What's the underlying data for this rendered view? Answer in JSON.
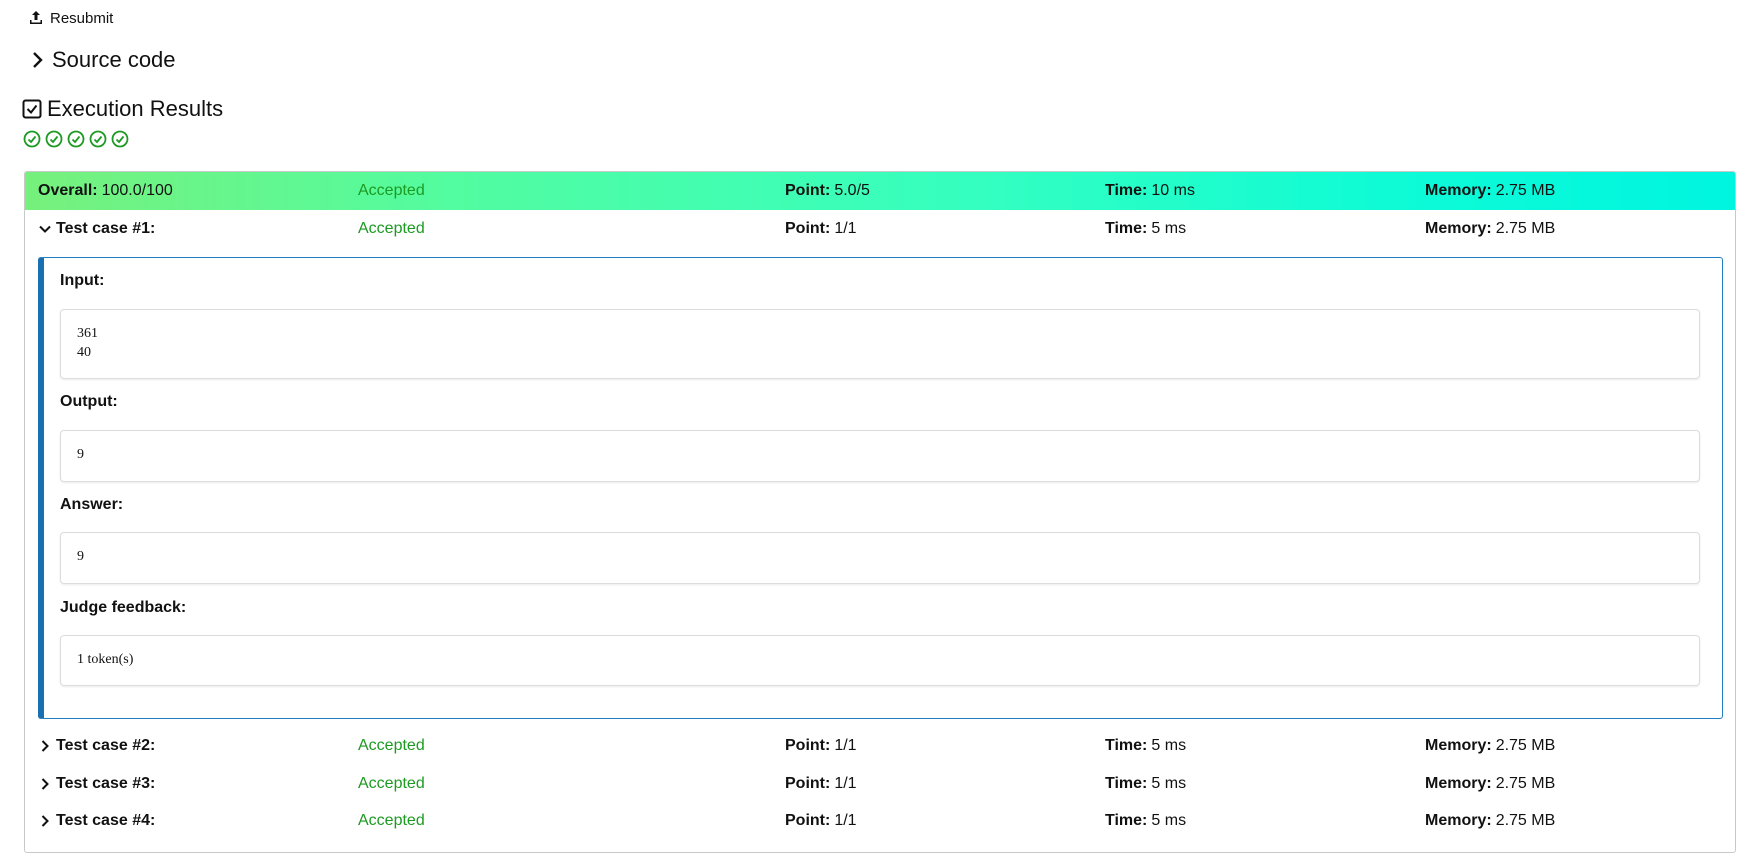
{
  "toolbar": {
    "resubmit_label": "Resubmit"
  },
  "source_code": {
    "label": "Source code"
  },
  "execution": {
    "title": "Execution Results",
    "check_count": 5
  },
  "labels": {
    "overall": "Overall:",
    "point": "Point:",
    "time": "Time:",
    "memory": "Memory:",
    "input": "Input:",
    "output": "Output:",
    "answer": "Answer:",
    "judge_feedback": "Judge feedback:"
  },
  "overall": {
    "score": "100.0/100",
    "status": "Accepted",
    "point": "5.0/5",
    "time": "10 ms",
    "memory": "2.75 MB"
  },
  "test_cases": [
    {
      "name": "Test case #1:",
      "status": "Accepted",
      "point": "1/1",
      "time": "5 ms",
      "memory": "2.75 MB",
      "expanded": true
    },
    {
      "name": "Test case #2:",
      "status": "Accepted",
      "point": "1/1",
      "time": "5 ms",
      "memory": "2.75 MB",
      "expanded": false
    },
    {
      "name": "Test case #3:",
      "status": "Accepted",
      "point": "1/1",
      "time": "5 ms",
      "memory": "2.75 MB",
      "expanded": false
    },
    {
      "name": "Test case #4:",
      "status": "Accepted",
      "point": "1/1",
      "time": "5 ms",
      "memory": "2.75 MB",
      "expanded": false
    }
  ],
  "detail": {
    "input": "361\n40",
    "output": "9",
    "answer": "9",
    "judge_feedback": "1 token(s)"
  },
  "colors": {
    "accepted": "#1d9a22",
    "detail_border": "#1a6fb0",
    "check": "#1d9a22"
  }
}
